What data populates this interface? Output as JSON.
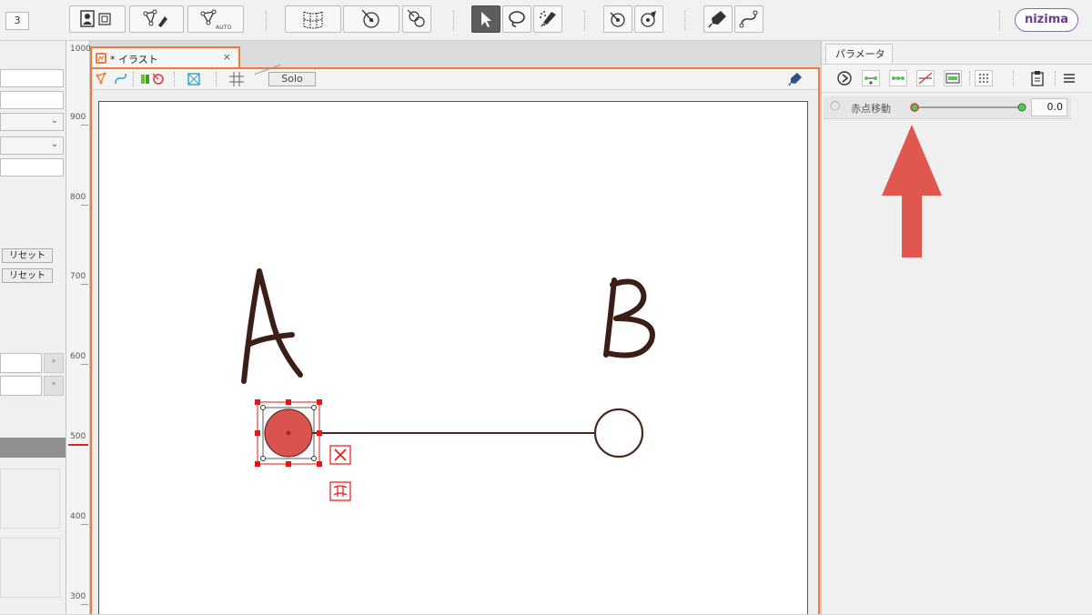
{
  "toolbar": {
    "layer_count": "3",
    "auto_label": "AUTO",
    "brand": "nizima"
  },
  "left_panel": {
    "reset_buttons": [
      "リセット",
      "リセット"
    ],
    "small_marks": [
      "*",
      "*"
    ]
  },
  "ruler": {
    "labels": [
      "1000",
      "900",
      "800",
      "700",
      "600",
      "500",
      "400",
      "300"
    ],
    "current_marker_color": "#e02020"
  },
  "document": {
    "tab_title": "* イラスト",
    "close": "×",
    "solo_label": "Solo"
  },
  "canvas": {
    "point_a_label": "A",
    "point_b_label": "B",
    "red_dot_color": "#d9534f",
    "line_color": "#4a2a20",
    "selection_color": "#e81515"
  },
  "parameters_panel": {
    "tab_label": "パラメータ",
    "param": {
      "name": "赤点移動",
      "value": "0.0",
      "slider_position": 0,
      "knob_color": "#5cc45c"
    },
    "arrow_color": "#e0574f"
  },
  "colors": {
    "accent_orange": "#ef7b3b",
    "panel_bg": "#f0f0f0"
  }
}
